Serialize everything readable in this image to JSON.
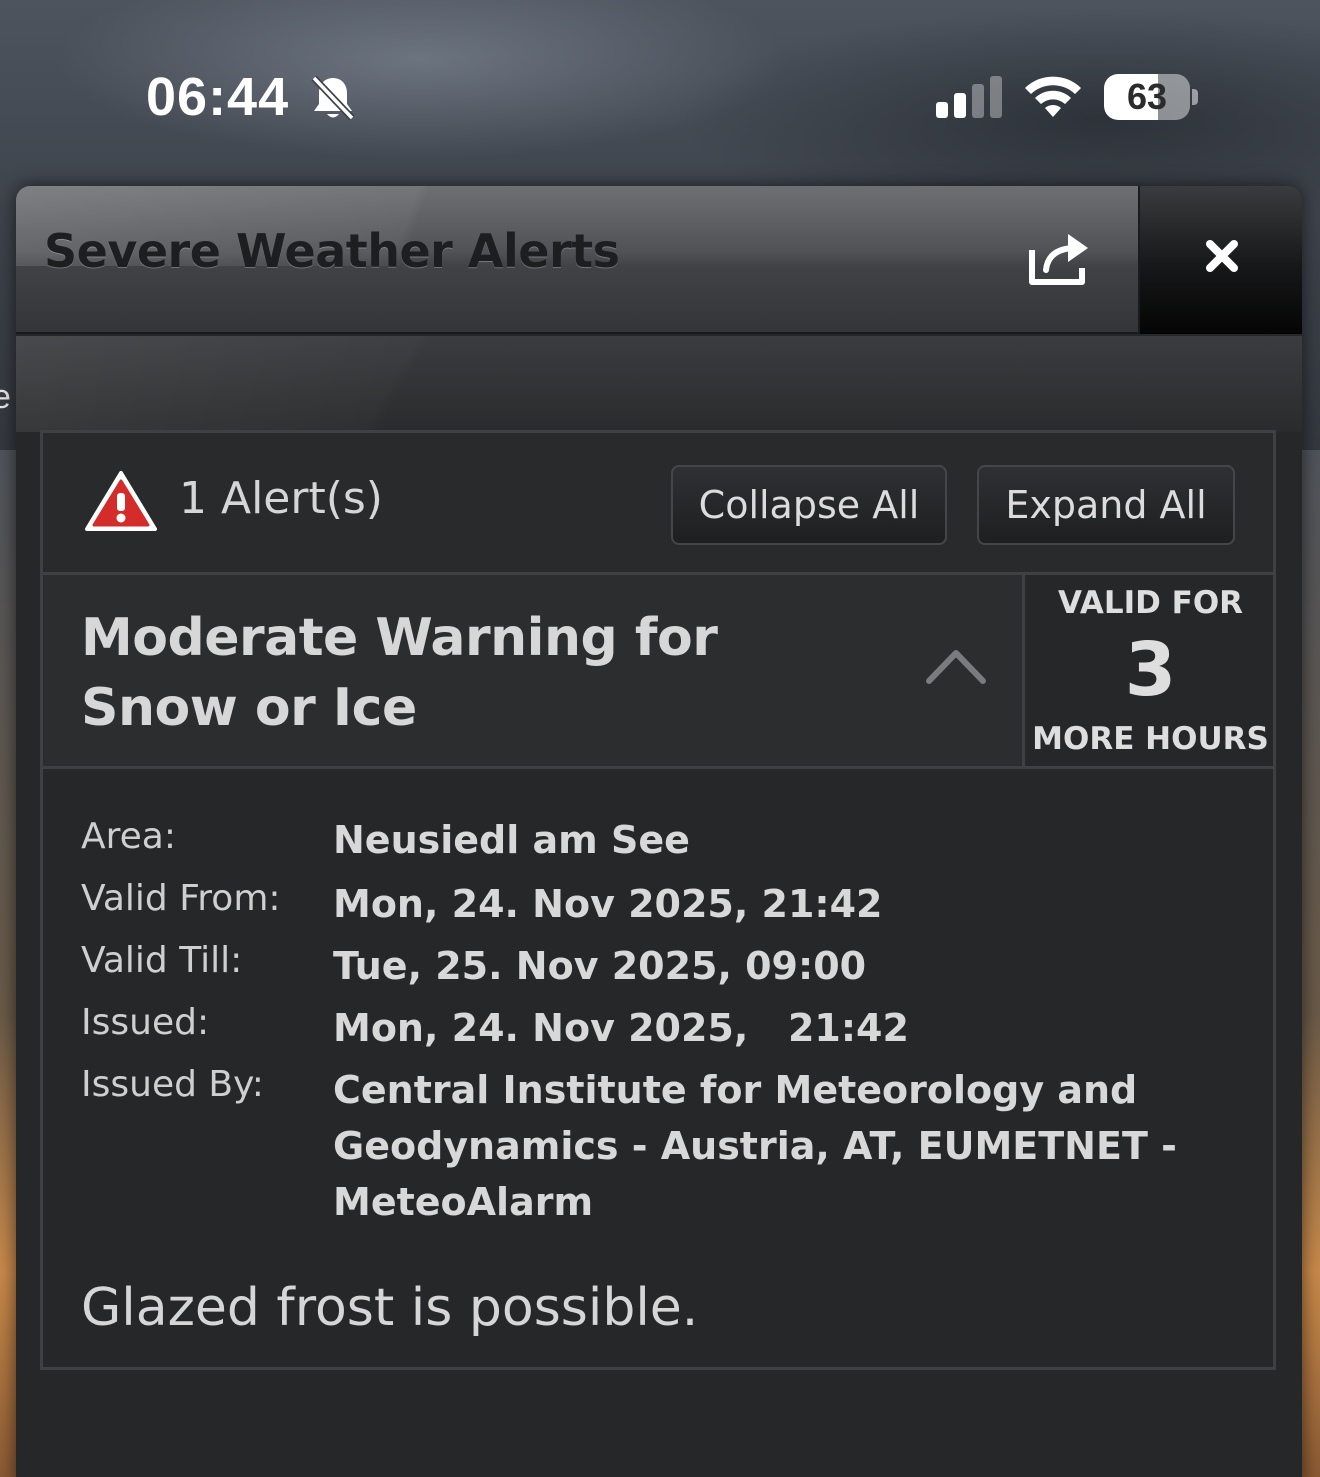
{
  "status_bar": {
    "time": "06:44",
    "battery_level": 63,
    "battery_label": "63",
    "signal_bars_active": 2,
    "signal_bars_total": 4,
    "icons": [
      "bell-off-icon",
      "signal-icon",
      "wifi-icon",
      "battery-icon"
    ]
  },
  "background": {
    "edge_letter": "e"
  },
  "panel": {
    "title": "Severe Weather Alerts",
    "share_icon": "share-icon",
    "close_icon": "close-icon"
  },
  "alerts": {
    "count_label": "1 Alert(s)",
    "warning_icon": "warning-triangle-icon",
    "warning_color": "#d42b2b",
    "collapse_label": "Collapse All",
    "expand_label": "Expand All",
    "items": [
      {
        "title": "Moderate Warning for Snow or Ice",
        "expanded": true,
        "valid_for_top": "VALID FOR",
        "valid_for_value": "3",
        "valid_for_bottom": "MORE HOURS",
        "details": [
          {
            "label": "Area:",
            "value": "Neusiedl am See"
          },
          {
            "label": "Valid From:",
            "value": "Mon, 24. Nov 2025, 21:42"
          },
          {
            "label": "Valid Till:",
            "value": "Tue, 25. Nov 2025, 09:00"
          },
          {
            "label": "Issued:",
            "value": "Mon, 24. Nov 2025,   21:42"
          },
          {
            "label": "Issued By:",
            "value": "Central Institute for Meteorology and Geodynamics - Austria, AT, EUMETNET - MeteoAlarm"
          }
        ],
        "description": "Glazed frost is possible."
      }
    ]
  }
}
